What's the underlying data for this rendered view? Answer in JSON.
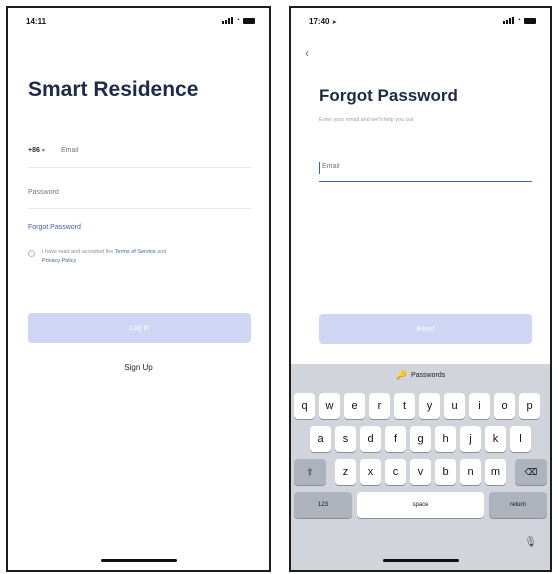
{
  "login": {
    "status_time": "14:11",
    "title": "Smart Residence",
    "country_code": "+86",
    "email_placeholder": "Email",
    "password_placeholder": "Password",
    "forgot_link": "Forgot Password",
    "agree_prefix": "I have read and accepted the",
    "terms_link": "Terms of Service",
    "agree_and": "and",
    "privacy_link": "Privacy Policy",
    "login_button": "Log In",
    "signup_link": "Sign Up"
  },
  "forgot": {
    "status_time": "17:40",
    "back": "‹",
    "title": "Forgot Password",
    "subtitle": "Enter your email and we'll help you out",
    "email_placeholder": "Email",
    "reset_button": "Reset",
    "keyboard": {
      "suggestion": "Passwords",
      "row1": [
        "q",
        "w",
        "e",
        "r",
        "t",
        "y",
        "u",
        "i",
        "o",
        "p"
      ],
      "row2": [
        "a",
        "s",
        "d",
        "f",
        "g",
        "h",
        "j",
        "k",
        "l"
      ],
      "row3": [
        "z",
        "x",
        "c",
        "v",
        "b",
        "n",
        "m"
      ],
      "shift_icon": "⇧",
      "delete_icon": "⌫",
      "numbers": "123",
      "space": "space",
      "return": "return",
      "mic_icon": "🎙"
    }
  },
  "colors": {
    "accent": "#3b5ea8",
    "title": "#1e2a4a",
    "button_disabled": "#cfd6f3",
    "keyboard_bg": "#d1d4da"
  }
}
